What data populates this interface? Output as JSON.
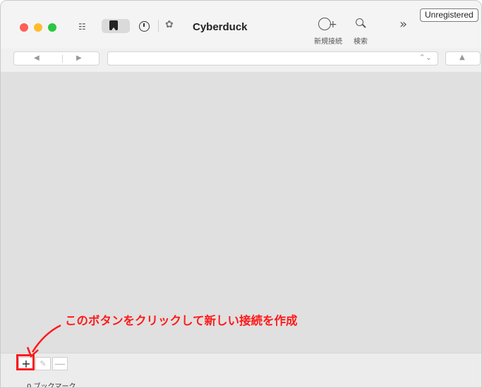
{
  "window": {
    "title": "Cyberduck",
    "registration_badge": "Unregistered"
  },
  "toolbar": {
    "new_connection_label": "新規接続",
    "search_label": "検索",
    "icons": {
      "outline": "outline-view-icon",
      "bookmarks": "bookmark-icon",
      "history": "history-clock-icon",
      "bonjour": "bonjour-icon",
      "new_connection": "globe-plus-icon",
      "search": "magnifier-icon",
      "overflow": "chevron-double-right-icon"
    }
  },
  "navigation": {
    "back_icon": "◀",
    "forward_icon": "▶",
    "path_chevron": "⌃⌄",
    "up_icon": "▲"
  },
  "annotation": {
    "text": "このボタンをクリックして新しい接続を作成",
    "color": "#ff1a1a"
  },
  "bottom_bar": {
    "add_label": "+",
    "edit_label": "✎",
    "remove_label": "—",
    "status": "0 ブックマーク"
  },
  "colors": {
    "traffic_red": "#ff5f57",
    "traffic_yellow": "#febc2e",
    "traffic_green": "#28c840"
  }
}
